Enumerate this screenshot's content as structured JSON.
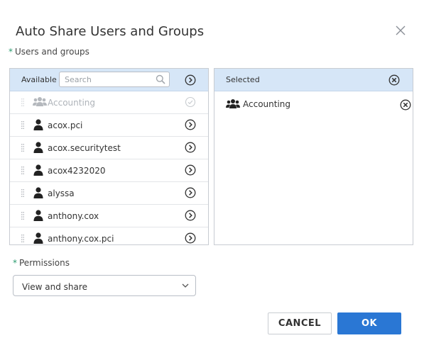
{
  "dialog": {
    "title": "Auto Share Users and Groups",
    "close_icon": "close-icon"
  },
  "users_and_groups": {
    "required_marker": "*",
    "label": "Users and groups"
  },
  "available": {
    "header_label": "Available",
    "search_placeholder": "Search",
    "search_value": "",
    "items": [
      {
        "label": "Accounting",
        "type": "group",
        "icon": "group-icon",
        "state": "already-selected"
      },
      {
        "label": "acox.pci",
        "type": "user",
        "icon": "user-icon",
        "state": "available"
      },
      {
        "label": "acox.securitytest",
        "type": "user",
        "icon": "user-icon",
        "state": "available"
      },
      {
        "label": "acox4232020",
        "type": "user",
        "icon": "user-icon",
        "state": "available"
      },
      {
        "label": "alyssa",
        "type": "user",
        "icon": "user-icon",
        "state": "available"
      },
      {
        "label": "anthony.cox",
        "type": "user",
        "icon": "user-icon",
        "state": "available"
      },
      {
        "label": "anthony.cox.pci",
        "type": "user",
        "icon": "user-icon",
        "state": "available"
      }
    ]
  },
  "selected": {
    "header_label": "Selected",
    "items": [
      {
        "label": "Accounting",
        "type": "group",
        "icon": "group-icon"
      }
    ]
  },
  "permissions": {
    "required_marker": "*",
    "label": "Permissions",
    "selected_value": "View and share"
  },
  "buttons": {
    "cancel": "CANCEL",
    "ok": "OK"
  },
  "colors": {
    "header_bg": "#d6e6f7",
    "primary": "#2a77d4",
    "required": "#2a9b6e"
  }
}
